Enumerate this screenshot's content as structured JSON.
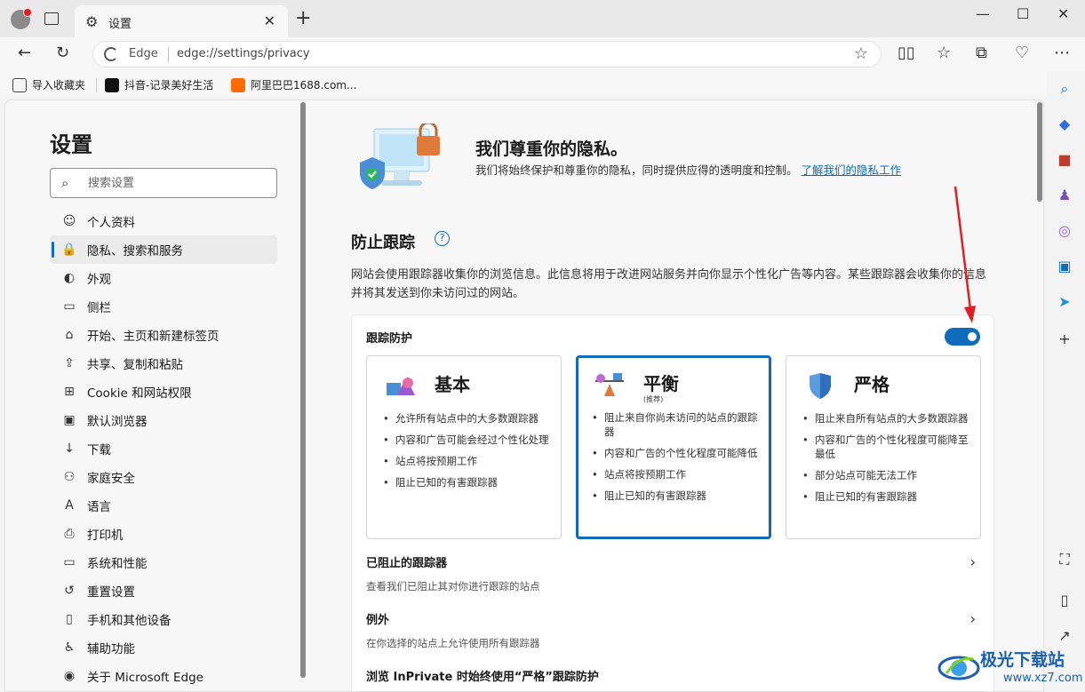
{
  "browser": {
    "tab_title": "设置",
    "site_label": "Edge",
    "url": "edge://settings/privacy"
  },
  "favorites": [
    {
      "label": "导入收藏夹",
      "icon": "import-favorites-icon"
    },
    {
      "label": "抖音-记录美好生活",
      "icon": "douyin-icon"
    },
    {
      "label": "阿里巴巴1688.com...",
      "icon": "alibaba-icon"
    }
  ],
  "nav": {
    "title": "设置",
    "search_placeholder": "搜索设置",
    "items": [
      {
        "label": "个人资料",
        "icon": "☺",
        "active": false
      },
      {
        "label": "隐私、搜索和服务",
        "icon": "🔒",
        "active": true
      },
      {
        "label": "外观",
        "icon": "◐",
        "active": false
      },
      {
        "label": "侧栏",
        "icon": "▭",
        "active": false
      },
      {
        "label": "开始、主页和新建标签页",
        "icon": "⌂",
        "active": false
      },
      {
        "label": "共享、复制和粘贴",
        "icon": "⇪",
        "active": false
      },
      {
        "label": "Cookie 和网站权限",
        "icon": "⊞",
        "active": false
      },
      {
        "label": "默认浏览器",
        "icon": "▣",
        "active": false
      },
      {
        "label": "下载",
        "icon": "↓",
        "active": false
      },
      {
        "label": "家庭安全",
        "icon": "⚇",
        "active": false
      },
      {
        "label": "语言",
        "icon": "A",
        "active": false
      },
      {
        "label": "打印机",
        "icon": "⎙",
        "active": false
      },
      {
        "label": "系统和性能",
        "icon": "▭",
        "active": false
      },
      {
        "label": "重置设置",
        "icon": "↺",
        "active": false
      },
      {
        "label": "手机和其他设备",
        "icon": "▯",
        "active": false
      },
      {
        "label": "辅助功能",
        "icon": "♿",
        "active": false
      },
      {
        "label": "关于 Microsoft Edge",
        "icon": "◉",
        "active": false
      }
    ]
  },
  "hero": {
    "title": "我们尊重你的隐私。",
    "desc": "我们将始终保护和尊重你的隐私，同时提供应得的透明度和控制。",
    "link": "了解我们的隐私工作"
  },
  "tracking": {
    "section_title": "防止跟踪",
    "section_desc": "网站会使用跟踪器收集你的浏览信息。此信息将用于改进网站服务并向你显示个性化广告等内容。某些跟踪器会收集你的信息并将其发送到你未访问过的网站。",
    "toggle_label": "跟踪防护",
    "toggle_on": true,
    "options": [
      {
        "title": "基本",
        "subtitle": "",
        "selected": false,
        "bullets": [
          "允许所有站点中的大多数跟踪器",
          "内容和广告可能会经过个性化处理",
          "站点将按预期工作",
          "阻止已知的有害跟踪器"
        ]
      },
      {
        "title": "平衡",
        "subtitle": "(推荐)",
        "selected": true,
        "bullets": [
          "阻止来自你尚未访问的站点的跟踪器",
          "内容和广告的个性化程度可能降低",
          "站点将按预期工作",
          "阻止已知的有害跟踪器"
        ]
      },
      {
        "title": "严格",
        "subtitle": "",
        "selected": false,
        "bullets": [
          "阻止来自所有站点的大多数跟踪器",
          "内容和广告的个性化程度可能降至最低",
          "部分站点可能无法工作",
          "阻止已知的有害跟踪器"
        ]
      }
    ],
    "rows": [
      {
        "title": "已阻止的跟踪器",
        "desc": "查看我们已阻止其对你进行跟踪的站点"
      },
      {
        "title": "例外",
        "desc": "在你选择的站点上允许使用所有跟踪器"
      },
      {
        "title": "浏览 InPrivate 时始终使用“严格”跟踪防护",
        "desc": ""
      }
    ]
  },
  "watermark": {
    "name": "极光下载站",
    "url": "www.xz7.com"
  },
  "colors": {
    "accent": "#0f6cbd",
    "annotation_arrow": "#e02020"
  }
}
